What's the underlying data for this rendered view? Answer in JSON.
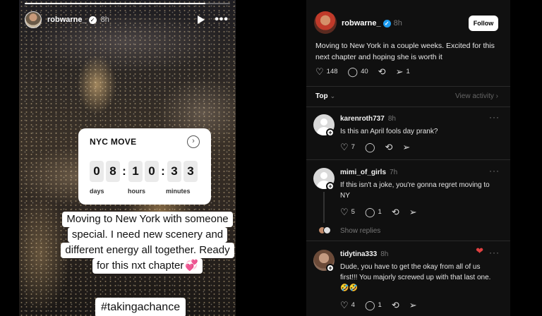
{
  "story": {
    "progress": 0.88,
    "username": "robwarne_",
    "verified_glyph": "✓",
    "time": "8h",
    "play_icon": "play-icon",
    "more_icon": "more-dots-icon",
    "more_glyph": "•••",
    "countdown": {
      "title": "NYC MOVE",
      "bell_glyph": "›",
      "digits": [
        "0",
        "8",
        "1",
        "0",
        "3",
        "3"
      ],
      "separator": ":",
      "units": [
        "days",
        "hours",
        "minutes"
      ]
    },
    "caption_lines": [
      "Moving to New York with someone",
      "special. I need new scenery and",
      "different energy all together. Ready",
      "for this nxt chapter"
    ],
    "caption_emoji": "💞",
    "hashtag": "#takingachance"
  },
  "threads": {
    "author": {
      "username": "robwarne_",
      "verified_glyph": "✓",
      "time": "8h",
      "follow_label": "Follow"
    },
    "post_text": "Moving to New York in a couple weeks. Excited for this next chapter and hoping she is worth it",
    "stats": {
      "likes": "148",
      "comments": "40",
      "reposts": "",
      "shares": "1"
    },
    "sort_label": "Top",
    "sort_chevron": "⌄",
    "view_activity": "View activity ›",
    "replies": [
      {
        "username": "karenroth737",
        "time": "8h",
        "text": "Is this an April fools day prank?",
        "likes": "7",
        "comments": "",
        "more": "···"
      },
      {
        "username": "mimi_of_girls",
        "time": "7h",
        "text": "If this isn't a joke, you're gonna regret moving to NY",
        "likes": "5",
        "comments": "1",
        "more": "···"
      },
      {
        "username": "tidytina333",
        "time": "8h",
        "text": "Dude, you have to get the okay from all of us first!!! You majorly screwed up with that last one. 🤣🤣",
        "likes": "4",
        "comments": "1",
        "more": "···"
      }
    ],
    "show_replies": "Show replies",
    "plus_glyph": "+",
    "glyphs": {
      "heart": "♡",
      "comment": "◯",
      "repost": "⟲",
      "share": "➢"
    }
  },
  "colors": {
    "background": "#000000",
    "threads_bg": "#101010",
    "verified_blue": "#1d9bf0",
    "card_white": "#ffffff"
  }
}
